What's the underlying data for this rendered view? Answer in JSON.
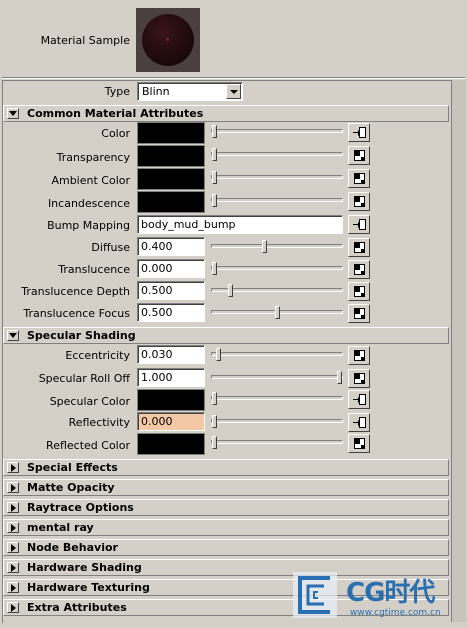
{
  "sample": {
    "label": "Material Sample"
  },
  "type_row": {
    "label": "Type",
    "value": "Blinn"
  },
  "common": {
    "header": "Common Material Attributes",
    "color_label": "Color",
    "transparency_label": "Transparency",
    "ambient_label": "Ambient Color",
    "incandescence_label": "Incandescence",
    "bump_label": "Bump Mapping",
    "bump_value": "body_mud_bump",
    "diffuse_label": "Diffuse",
    "diffuse_value": "0.400",
    "translucence_label": "Translucence",
    "translucence_value": "0.000",
    "transdepth_label": "Translucence Depth",
    "transdepth_value": "0.500",
    "transfocus_label": "Translucence Focus",
    "transfocus_value": "0.500"
  },
  "specular": {
    "header": "Specular Shading",
    "eccentricity_label": "Eccentricity",
    "eccentricity_value": "0.030",
    "rolloff_label": "Specular Roll Off",
    "rolloff_value": "1.000",
    "speccolor_label": "Specular Color",
    "reflectivity_label": "Reflectivity",
    "reflectivity_value": "0.000",
    "reflected_label": "Reflected Color"
  },
  "sliders": {
    "color": 0.0,
    "transparency": 0.0,
    "ambient": 0.0,
    "incandescence": 0.0,
    "diffuse": 0.4,
    "translucence": 0.0,
    "transdepth": 0.125,
    "transfocus": 0.5,
    "eccentricity": 0.03,
    "rolloff": 1.0,
    "speccolor": 0.0,
    "reflectivity": 0.0,
    "reflected": 0.0
  },
  "collapsed_sections": {
    "special_effects": "Special Effects",
    "matte_opacity": "Matte Opacity",
    "raytrace_options": "Raytrace Options",
    "mental_ray": "mental ray",
    "node_behavior": "Node Behavior",
    "hardware_shading": "Hardware Shading",
    "hardware_texturing": "Hardware Texturing",
    "extra_attributes": "Extra Attributes"
  },
  "watermark": {
    "brand": "CG时代",
    "url": "www.cgtime.com.cn"
  },
  "colors": {
    "background": "#d4d0c8",
    "swatch": "#000000",
    "reflectivity_field": "#f2c9a4",
    "watermark_blue": "#2a6fb0"
  },
  "icons": {
    "mapped_button": "arrow-into-box-icon",
    "map_button": "checker-icon",
    "expand": "triangle-right-icon",
    "collapse": "triangle-down-icon"
  }
}
